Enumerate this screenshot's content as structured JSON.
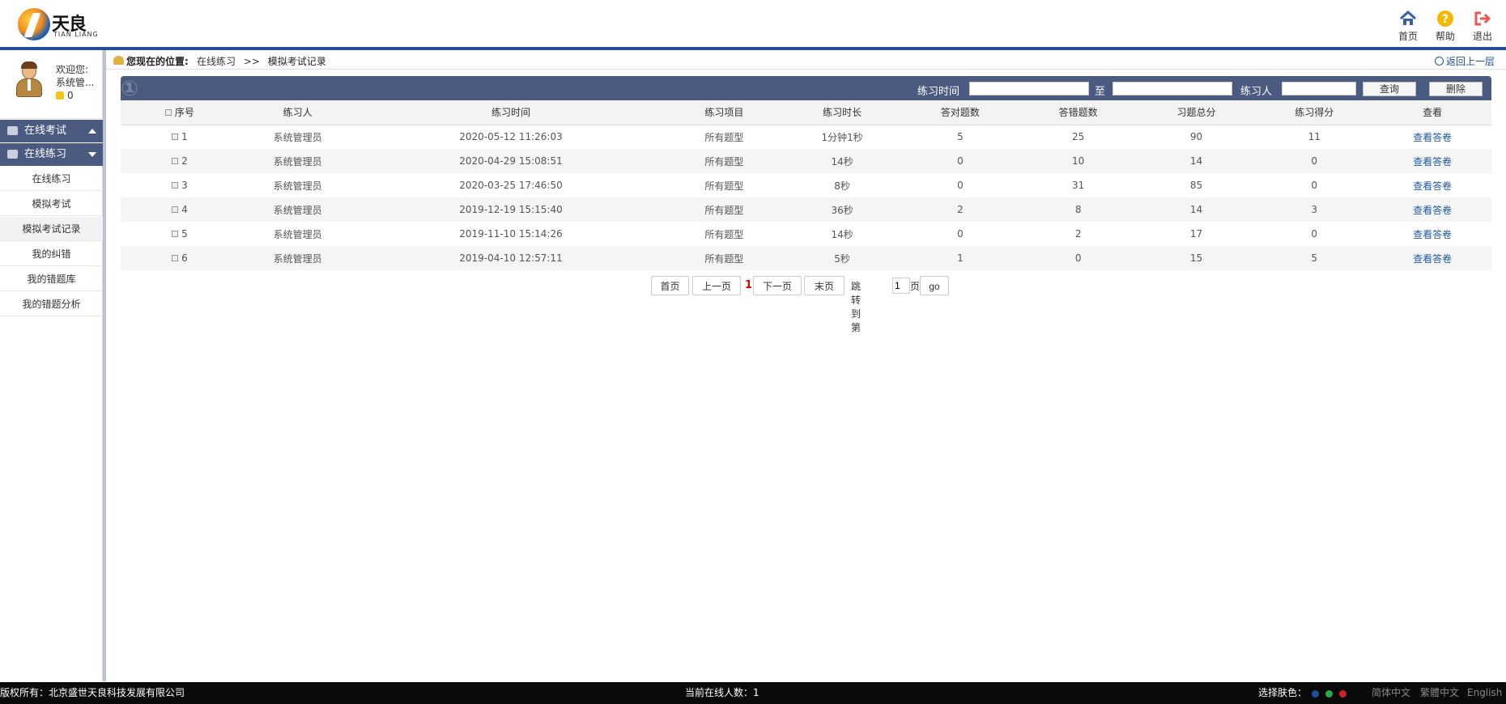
{
  "header": {
    "logo_cn": "天良",
    "logo_en": "TIAN LIANG",
    "nav": [
      {
        "label": "首页",
        "icon": "home-icon",
        "color": "#3a5fa8"
      },
      {
        "label": "帮助",
        "icon": "help-icon",
        "color": "#f5b800"
      },
      {
        "label": "退出",
        "icon": "logout-icon",
        "color": "#e55"
      }
    ]
  },
  "user": {
    "welcome": "欢迎您:",
    "name": "系统管...",
    "coins": "0"
  },
  "sidebar": {
    "categories": [
      {
        "label": "在线考试",
        "expanded": false
      },
      {
        "label": "在线练习",
        "expanded": true
      }
    ],
    "items": [
      {
        "label": "在线练习"
      },
      {
        "label": "模拟考试"
      },
      {
        "label": "模拟考试记录",
        "active": true
      },
      {
        "label": "我的纠错"
      },
      {
        "label": "我的错题库"
      },
      {
        "label": "我的错题分析"
      }
    ]
  },
  "breadcrumb": {
    "label": "您现在的位置:",
    "path": [
      "在线练习",
      "模拟考试记录"
    ],
    "separator": ">>",
    "back": "返回上一层"
  },
  "search": {
    "time_label": "练习时间",
    "to_label": "至",
    "person_label": "练习人",
    "time_from": "",
    "time_to": "",
    "person": "",
    "query_button": "查询",
    "delete_button": "删除"
  },
  "table": {
    "columns": [
      "序号",
      "练习人",
      "练习时间",
      "练习项目",
      "练习时长",
      "答对题数",
      "答错题数",
      "习题总分",
      "练习得分",
      "查看"
    ],
    "rows": [
      {
        "no": "1",
        "person": "系统管理员",
        "time": "2020-05-12 11:26:03",
        "project": "所有题型",
        "duration": "1分钟1秒",
        "correct": "5",
        "wrong": "25",
        "total": "90",
        "score": "11",
        "view": "查看答卷"
      },
      {
        "no": "2",
        "person": "系统管理员",
        "time": "2020-04-29 15:08:51",
        "project": "所有题型",
        "duration": "14秒",
        "correct": "0",
        "wrong": "10",
        "total": "14",
        "score": "0",
        "view": "查看答卷"
      },
      {
        "no": "3",
        "person": "系统管理员",
        "time": "2020-03-25 17:46:50",
        "project": "所有题型",
        "duration": "8秒",
        "correct": "0",
        "wrong": "31",
        "total": "85",
        "score": "0",
        "view": "查看答卷"
      },
      {
        "no": "4",
        "person": "系统管理员",
        "time": "2019-12-19 15:15:40",
        "project": "所有题型",
        "duration": "36秒",
        "correct": "2",
        "wrong": "8",
        "total": "14",
        "score": "3",
        "view": "查看答卷"
      },
      {
        "no": "5",
        "person": "系统管理员",
        "time": "2019-11-10 15:14:26",
        "project": "所有题型",
        "duration": "14秒",
        "correct": "0",
        "wrong": "2",
        "total": "17",
        "score": "0",
        "view": "查看答卷"
      },
      {
        "no": "6",
        "person": "系统管理员",
        "time": "2019-04-10 12:57:11",
        "project": "所有题型",
        "duration": "5秒",
        "correct": "1",
        "wrong": "0",
        "total": "15",
        "score": "5",
        "view": "查看答卷"
      }
    ]
  },
  "pager": {
    "first": "首页",
    "prev": "上一页",
    "current": "1",
    "next": "下一页",
    "last": "末页",
    "jump_label": "跳转到第",
    "jump_value": "1",
    "page_unit": "页",
    "go": "go"
  },
  "footer": {
    "copyright": "版权所有：北京盛世天良科技发展有限公司",
    "online": "当前在线人数：1",
    "skin_label": "选择肤色：",
    "skins": [
      "#1f4e9c",
      "#2aa84a",
      "#d42020"
    ],
    "langs": [
      "简体中文",
      "繁體中文",
      "English"
    ]
  },
  "colors": {
    "accent": "#1f4e9c",
    "bar": "#4a5a80",
    "link": "#1f5aa6",
    "current_page": "#dd0000"
  }
}
